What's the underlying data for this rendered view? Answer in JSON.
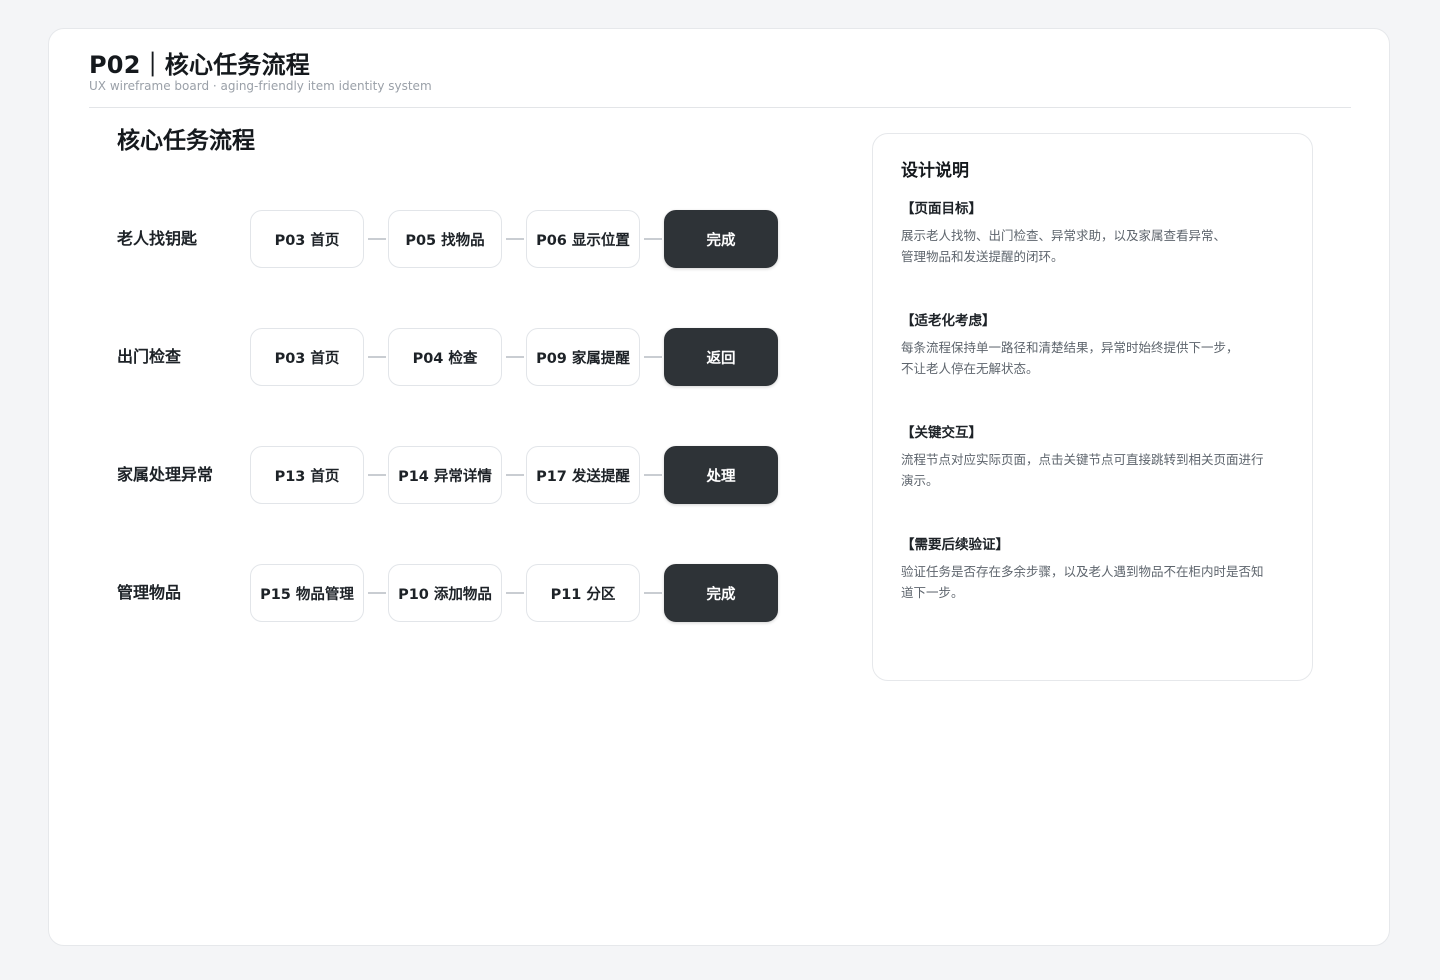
{
  "board": {
    "title": "P02｜核心任务流程",
    "subtitle": "UX wireframe board · aging-friendly item identity system"
  },
  "section": {
    "title": "核心任务流程"
  },
  "flows": [
    {
      "label": "老人找钥匙",
      "steps": [
        "P03 首页",
        "P05 找物品",
        "P06 显示位置"
      ],
      "end": "完成"
    },
    {
      "label": "出门检查",
      "steps": [
        "P03 首页",
        "P04 检查",
        "P09 家属提醒"
      ],
      "end": "返回"
    },
    {
      "label": "家属处理异常",
      "steps": [
        "P13 首页",
        "P14 异常详情",
        "P17 发送提醒"
      ],
      "end": "处理"
    },
    {
      "label": "管理物品",
      "steps": [
        "P15 物品管理",
        "P10 添加物品",
        "P11 分区"
      ],
      "end": "完成"
    }
  ],
  "notes": {
    "title": "设计说明",
    "items": [
      {
        "heading": "【页面目标】",
        "body": "展示老人找物、出门检查、异常求助，以及家属查看异常、\n管理物品和发送提醒的闭环。"
      },
      {
        "heading": "【适老化考虑】",
        "body": "每条流程保持单一路径和清楚结果，异常时始终提供下一步，\n不让老人停在无解状态。"
      },
      {
        "heading": "【关键交互】",
        "body": "流程节点对应实际页面，点击关键节点可直接跳转到相关页面进行\n演示。"
      },
      {
        "heading": "【需要后续验证】",
        "body": "验证任务是否存在多余步骤，以及老人遇到物品不在柜内时是否知\n道下一步。"
      }
    ]
  }
}
